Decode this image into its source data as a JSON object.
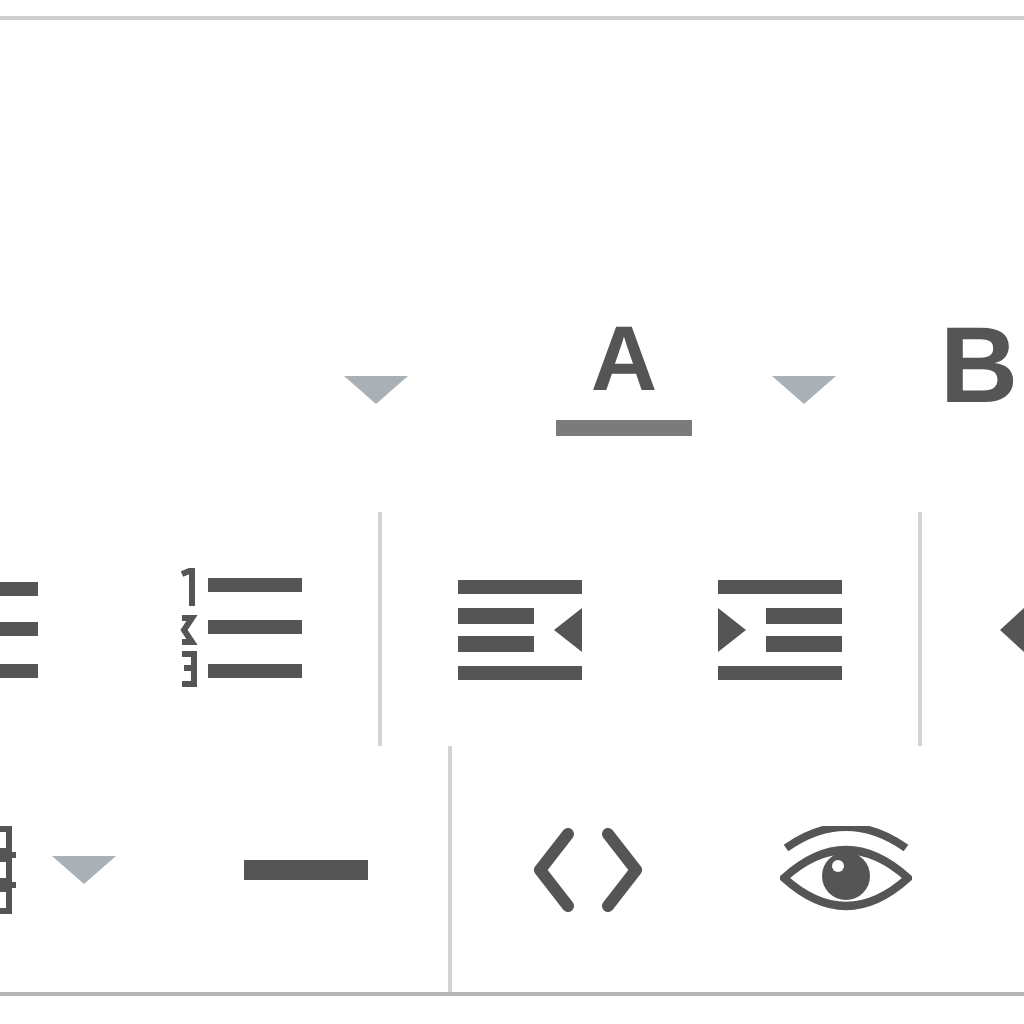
{
  "toolbar": {
    "rows": [
      [
        {
          "kind": "caret"
        },
        {
          "kind": "text-color",
          "label": "A"
        },
        {
          "kind": "caret"
        },
        {
          "kind": "bold",
          "label": "B"
        }
      ],
      [
        {
          "kind": "bulleted-list"
        },
        {
          "kind": "numbered-list"
        },
        {
          "kind": "divider"
        },
        {
          "kind": "outdent"
        },
        {
          "kind": "indent"
        },
        {
          "kind": "divider"
        },
        {
          "kind": "arrow"
        }
      ],
      [
        {
          "kind": "table"
        },
        {
          "kind": "caret"
        },
        {
          "kind": "horizontal-rule"
        },
        {
          "kind": "divider"
        },
        {
          "kind": "code"
        },
        {
          "kind": "preview"
        }
      ]
    ]
  }
}
